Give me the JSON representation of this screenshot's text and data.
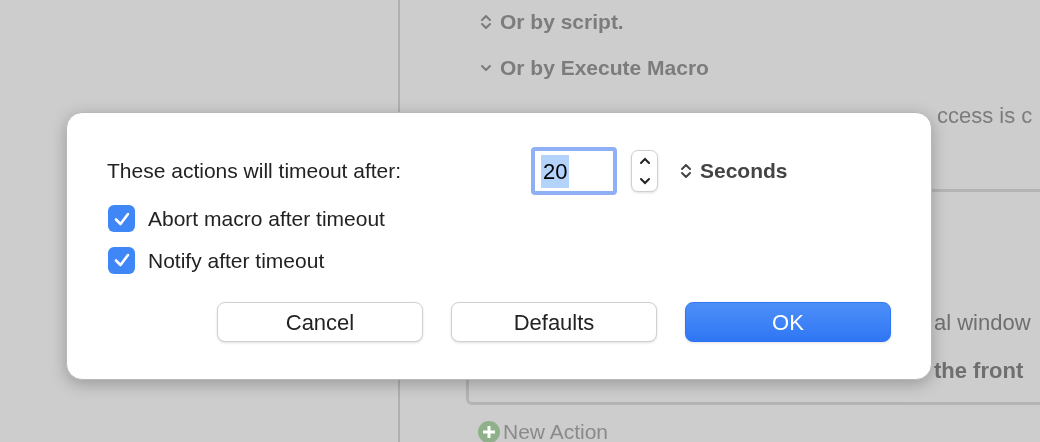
{
  "background": {
    "sections": [
      {
        "kind": "popup",
        "label": "Or by script."
      },
      {
        "kind": "disclosure",
        "label": "Or by Execute Macro"
      }
    ],
    "note": "ccess is c",
    "box_texts": [
      "al window",
      "the front"
    ],
    "new_action": "New Action"
  },
  "dialog": {
    "label": "These actions will timeout after:",
    "timeout": {
      "value": "20",
      "selected": true
    },
    "unit": "Seconds",
    "options": [
      {
        "label": "Abort macro after timeout",
        "checked": true
      },
      {
        "label": "Notify after timeout",
        "checked": true
      }
    ],
    "buttons": [
      {
        "label": "Cancel",
        "kind": "normal"
      },
      {
        "label": "Defaults",
        "kind": "normal"
      },
      {
        "label": "OK",
        "kind": "default"
      }
    ]
  }
}
